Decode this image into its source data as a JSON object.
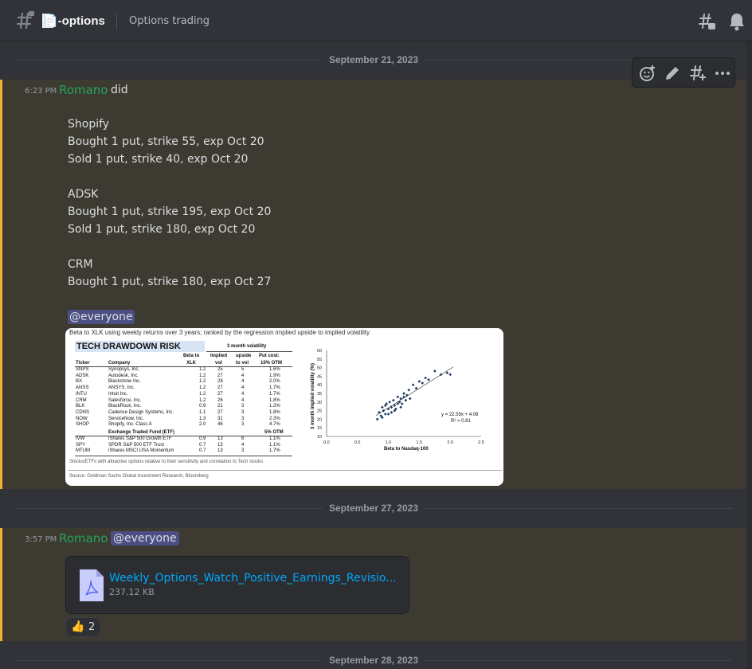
{
  "header": {
    "channel_name": "📄-options",
    "topic": "Options trading"
  },
  "dates": [
    "September 21, 2023",
    "September 27, 2023",
    "September 28, 2023"
  ],
  "message1": {
    "timestamp": "6:23 PM",
    "author": "Romano",
    "first_text": "did",
    "lines": [
      "Shopify",
      "Bought 1 put, strike 55, exp Oct 20",
      "Sold 1 put, strike 40, exp Oct 20",
      "ADSK",
      "Bought 1 put, strike 195, exp Oct 20",
      "Sold 1 put, strike 180, exp Oct 20",
      "CRM",
      "Bought 1 put, strike 180, exp Oct 27"
    ],
    "mention": "@everyone"
  },
  "embed": {
    "caption": "Beta to XLK using weekly returns over 3 years; ranked by the regression implied upside to implied volatility",
    "title": "TECH DRAWDOWN RISK",
    "group_header": "3 month volatility",
    "columns": [
      "Ticker",
      "Company",
      "Beta to XLK",
      "Implied vol",
      "upside to vol",
      "Put cost: 10% OTM"
    ],
    "rows": [
      [
        "SNPS",
        "Synopsys, Inc.",
        "1.2",
        "25",
        "5",
        "1.6%"
      ],
      [
        "ADSK",
        "Autodesk, Inc.",
        "1.2",
        "27",
        "4",
        "1.9%"
      ],
      [
        "BX",
        "Blackstone Inc.",
        "1.2",
        "28",
        "4",
        "2.0%"
      ],
      [
        "ANSS",
        "ANSYS, Inc.",
        "1.2",
        "27",
        "4",
        "1.7%"
      ],
      [
        "INTU",
        "Intuit Inc.",
        "1.2",
        "27",
        "4",
        "1.7%"
      ],
      [
        "CRM",
        "Salesforce, Inc.",
        "1.2",
        "26",
        "4",
        "1.8%"
      ],
      [
        "BLK",
        "BlackRock, Inc.",
        "0.9",
        "21",
        "3",
        "1.2%"
      ],
      [
        "CDNS",
        "Cadence Design Systems, Inc.",
        "1.1",
        "27",
        "3",
        "1.8%"
      ],
      [
        "NOW",
        "ServiceNow, Inc.",
        "1.3",
        "31",
        "3",
        "2.3%"
      ],
      [
        "SHOP",
        "Shopify, Inc. Class A",
        "2.0",
        "46",
        "3",
        "4.7%"
      ]
    ],
    "etf_header": "Exchange Traded Fund (ETF)",
    "etf_otm": "5% OTM",
    "etf_rows": [
      [
        "IVW",
        "iShares S&P 500 Growth ETF",
        "0.9",
        "13",
        "6",
        "1.1%"
      ],
      [
        "SPY",
        "SPDR S&P 500 ETF Trust",
        "0.7",
        "13",
        "4",
        "1.1%"
      ],
      [
        "MTUM",
        "iShares MSCI USA Momentum",
        "0.7",
        "13",
        "3",
        "1.7%"
      ]
    ],
    "footnote": "Stocks/ETFs with attractive options relative to their sensitivity and correlation to Tech stocks",
    "source": "Source: Goldman Sachs Global Investment Research, Bloomberg",
    "chart": {
      "ylabel": "3 month implied volatility (%)",
      "xlabel": "Beta to Nasdaq-100",
      "xticks": [
        "0.0",
        "0.5",
        "1.0",
        "1.5",
        "2.0",
        "2.5"
      ],
      "yticks": [
        "60",
        "55",
        "50",
        "45",
        "40",
        "35",
        "30",
        "25",
        "20",
        "15",
        "10"
      ],
      "eq": "y = 22.59x + 4.08",
      "r2": "R² = 0.81"
    }
  },
  "message2": {
    "timestamp": "3:57 PM",
    "author": "Romano",
    "mention": "@everyone",
    "file_name": "Weekly_Options_Watch_Positive_Earnings_Revisio...",
    "file_size": "237.12 KB",
    "reaction_emoji": "👍",
    "reaction_count": "2"
  },
  "colors": {
    "author": "#23a55a",
    "link": "#00a8fc",
    "highlight_border": "#f0b232",
    "mention_bg": "#4b4f83"
  }
}
